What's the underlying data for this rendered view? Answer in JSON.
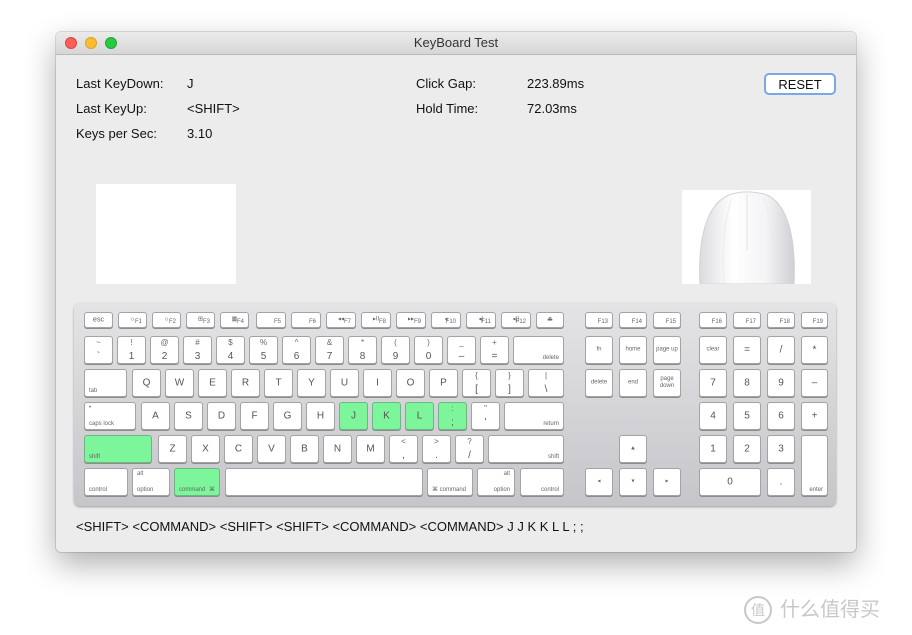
{
  "window": {
    "title": "KeyBoard Test"
  },
  "stats": {
    "last_keydown_label": "Last KeyDown:",
    "last_keydown_value": "J",
    "last_keyup_label": "Last KeyUp:",
    "last_keyup_value": "<SHIFT>",
    "kps_label": "Keys per Sec:",
    "kps_value": "3.10",
    "click_gap_label": "Click Gap:",
    "click_gap_value": "223.89ms",
    "hold_time_label": "Hold Time:",
    "hold_time_value": "72.03ms"
  },
  "buttons": {
    "reset": "RESET"
  },
  "history": "<SHIFT> <COMMAND> <SHIFT> <SHIFT> <COMMAND> <COMMAND> J J K K L L ; ;",
  "watermark": {
    "text": "什么值得买"
  },
  "colors": {
    "active_key": "#7cf59b",
    "reset_border": "#7aa7e6"
  },
  "keyboard": {
    "active_keys": [
      "shift-left",
      "command-left",
      "J",
      "K",
      "L",
      ";"
    ],
    "labels": {
      "esc": "esc",
      "f1": "F1",
      "f2": "F2",
      "f3": "F3",
      "f4": "F4",
      "f5": "F5",
      "f6": "F6",
      "f7": "F7",
      "f8": "F8",
      "f9": "F9",
      "f10": "F10",
      "f11": "F11",
      "f12": "F12",
      "f13": "F13",
      "f14": "F14",
      "f15": "F15",
      "f16": "F16",
      "f17": "F17",
      "f18": "F18",
      "f19": "F19",
      "delete": "delete",
      "tab": "tab",
      "caps": "caps lock",
      "return": "return",
      "shift": "shift",
      "control": "control",
      "option": "option",
      "command": "command",
      "alt": "alt",
      "fn": "fn",
      "home": "home",
      "pageup": "page up",
      "delfwd": "delete",
      "end": "end",
      "pagedown": "page down",
      "clear": "clear",
      "enter": "enter"
    }
  }
}
